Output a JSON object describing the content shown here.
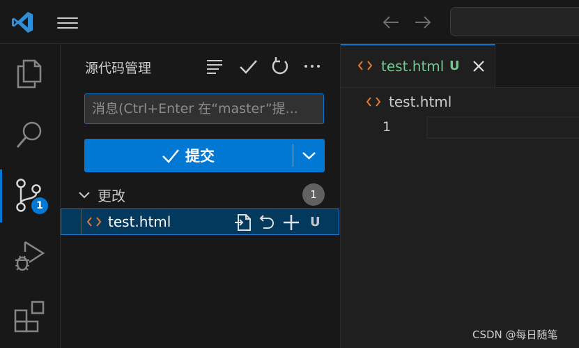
{
  "titlebar": {
    "logo_icon": "vscode-logo-icon",
    "menu_icon": "hamburger-menu-icon",
    "back_icon": "arrow-left-icon",
    "forward_icon": "arrow-right-icon"
  },
  "activity_bar": {
    "items": [
      {
        "name": "explorer",
        "icon": "files-icon"
      },
      {
        "name": "search",
        "icon": "search-icon"
      },
      {
        "name": "source-control",
        "icon": "source-control-icon",
        "active": true,
        "badge": "1"
      },
      {
        "name": "run-debug",
        "icon": "run-debug-icon"
      },
      {
        "name": "extensions",
        "icon": "extensions-icon"
      }
    ]
  },
  "scm": {
    "title": "源代码管理",
    "actions": [
      "view-as-tree-icon",
      "commit-check-icon",
      "refresh-icon",
      "more-icon"
    ],
    "message_placeholder": "消息(Ctrl+Enter 在“master”提...",
    "commit_label": "提交",
    "changes": {
      "label": "更改",
      "count": "1",
      "files": [
        {
          "name": "test.html",
          "status": "U"
        }
      ]
    }
  },
  "editor": {
    "tab": {
      "name": "test.html",
      "status": "U"
    },
    "breadcrumb": "test.html",
    "line_number": "1"
  },
  "colors": {
    "accent": "#0078d4",
    "untracked": "#73c991",
    "html_icon": "#e37933"
  },
  "watermark": "CSDN @每日随笔"
}
